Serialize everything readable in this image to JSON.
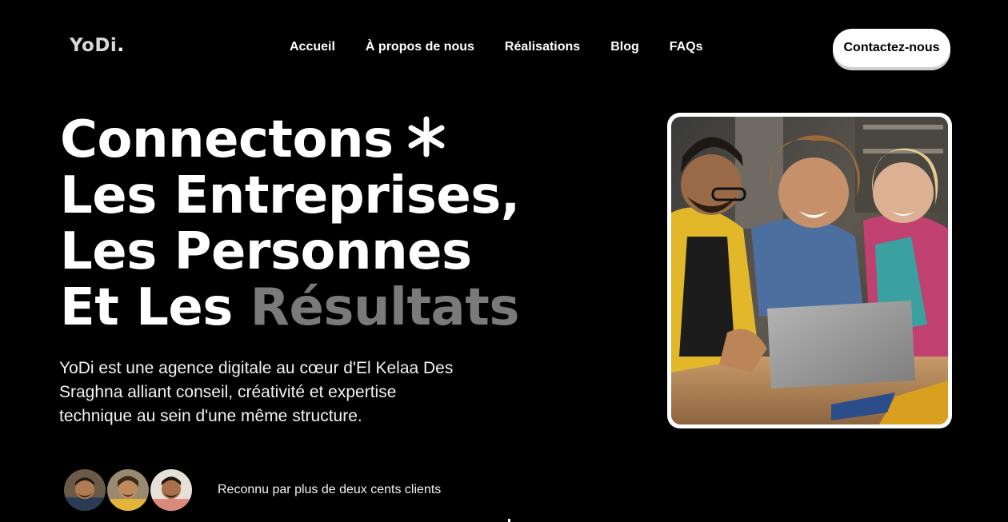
{
  "logo": {
    "text": "YoDi",
    "dot": "."
  },
  "nav": {
    "items": [
      {
        "label": "Accueil"
      },
      {
        "label": "À propos de nous"
      },
      {
        "label": "Réalisations"
      },
      {
        "label": "Blog"
      },
      {
        "label": "FAQs"
      }
    ]
  },
  "cta": {
    "label": "Contactez-nous"
  },
  "hero": {
    "title_line1": "Connectons",
    "title_line2": "Les Entreprises,",
    "title_line3": "Les Personnes",
    "title_line4_prefix": "Et Les",
    "title_line4_highlight": "Résultats",
    "description": "YoDi est une agence digitale au cœur d'El Kelaa Des Sraghna alliant conseil, créativité et expertise technique au sein d'une même structure.",
    "trust_text": "Reconnu par plus de deux cents clients"
  },
  "colors": {
    "background": "#000000",
    "text": "#ffffff",
    "muted": "#7a7a7a",
    "accent_yellow": "#e8b820"
  },
  "icons": {
    "asterisk": "asterisk-icon"
  }
}
